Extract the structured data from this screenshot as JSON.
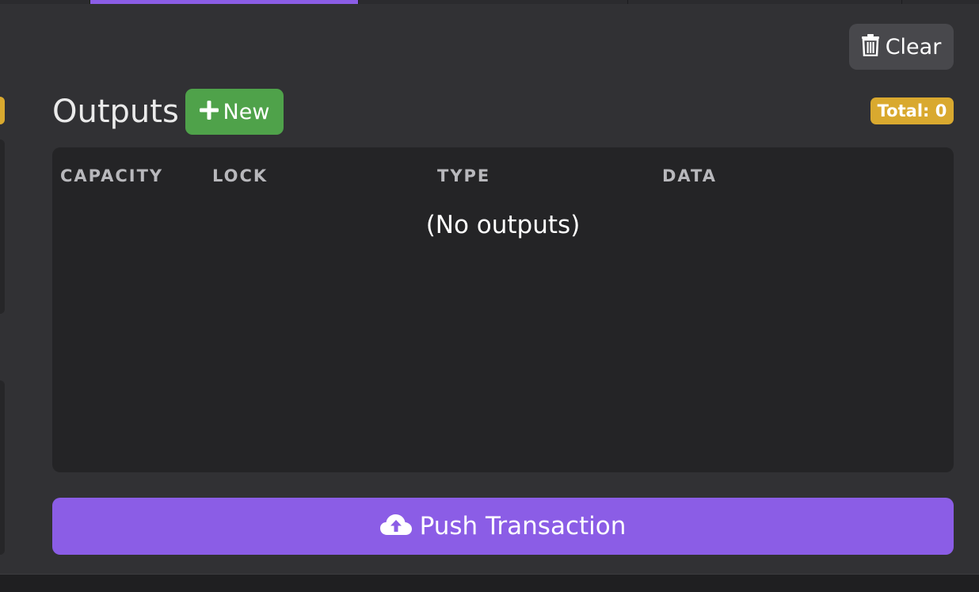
{
  "toolbar": {
    "clear_label": "Clear",
    "clear_icon": "trash-icon"
  },
  "outputs": {
    "title": "Outputs",
    "new_label": "New",
    "new_icon": "plus-icon",
    "total_label": "Total: 0",
    "columns": [
      "CAPACITY",
      "LOCK",
      "TYPE",
      "DATA"
    ],
    "empty_message": "(No outputs)"
  },
  "actions": {
    "push_label": "Push Transaction",
    "push_icon": "cloud-upload-icon"
  },
  "colors": {
    "accent": "#8b5de6",
    "success": "#4fa24a",
    "warning": "#d9a92f",
    "background": "#313134",
    "panel": "#242426"
  }
}
